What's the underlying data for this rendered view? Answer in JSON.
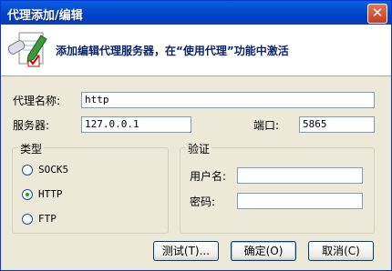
{
  "window": {
    "title": "代理添加/编辑",
    "close_symbol": "✕"
  },
  "banner": {
    "text": "添加编辑代理服务器，在“使用代理”功能中激活"
  },
  "form": {
    "name_label": "代理名称:",
    "name_value": "http",
    "server_label": "服务器:",
    "server_value": "127.0.0.1",
    "port_label": "端口:",
    "port_value": "5865"
  },
  "type_group": {
    "legend": "类型",
    "options": [
      {
        "label": "SOCK5",
        "selected": false
      },
      {
        "label": "HTTP",
        "selected": true
      },
      {
        "label": "FTP",
        "selected": false
      }
    ]
  },
  "auth_group": {
    "legend": "验证",
    "username_label": "用户名:",
    "username_value": "",
    "password_label": "密码:",
    "password_value": ""
  },
  "buttons": {
    "test": "测试(T)...",
    "ok": "确定(O)",
    "cancel": "取消(C)"
  }
}
